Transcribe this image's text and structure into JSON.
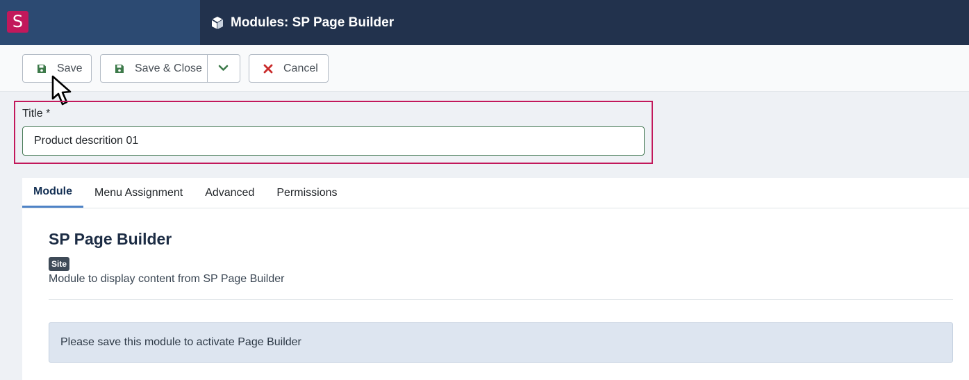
{
  "header": {
    "logo_letter": "S",
    "title": "Modules: SP Page Builder",
    "icon": "cube-icon"
  },
  "toolbar": {
    "save_label": "Save",
    "save_close_label": "Save & Close",
    "cancel_label": "Cancel",
    "save_icon": "floppy-disk-icon",
    "cancel_icon": "x-icon",
    "dropdown_icon": "chevron-down-icon"
  },
  "title_field": {
    "label": "Title *",
    "value": "Product descrition 01"
  },
  "tabs": [
    {
      "label": "Module",
      "active": true
    },
    {
      "label": "Menu Assignment",
      "active": false
    },
    {
      "label": "Advanced",
      "active": false
    },
    {
      "label": "Permissions",
      "active": false
    }
  ],
  "module": {
    "name": "SP Page Builder",
    "badge": "Site",
    "description": "Module to display content from SP Page Builder",
    "notice": "Please save this module to activate Page Builder"
  },
  "colors": {
    "header_bg": "#22324d",
    "brand_bg": "#2c4a72",
    "logo_bg": "#c2185b",
    "highlight_border": "#c2185b",
    "save_icon": "#3d7a4a",
    "cancel_icon": "#c92a2a",
    "notice_bg": "#dde5f0"
  }
}
